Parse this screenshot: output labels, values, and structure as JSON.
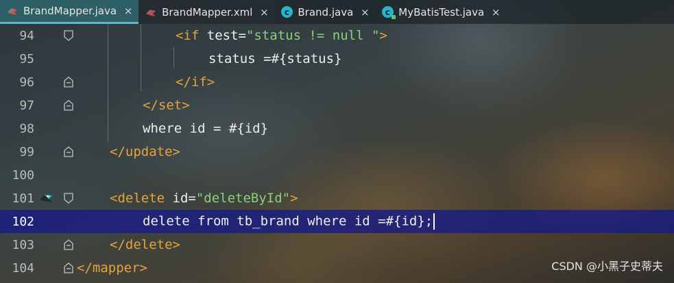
{
  "tabs": [
    {
      "label": "BrandMapper.java",
      "icon": "java-interface-icon",
      "state": "active"
    },
    {
      "label": "BrandMapper.xml",
      "icon": "mybatis-xml-icon",
      "state": "hovered"
    },
    {
      "label": "Brand.java",
      "icon": "java-class-icon",
      "state": "normal"
    },
    {
      "label": "MyBatisTest.java",
      "icon": "java-test-class-icon",
      "state": "normal"
    }
  ],
  "tab_close_glyph": "×",
  "colors": {
    "tag": "#e8a33a",
    "string": "#8bd17c",
    "current_line": "#1a1c82",
    "active_tab": "#3c8c96"
  },
  "lines": [
    {
      "number": "94",
      "tag_open": "<if ",
      "attr": "test=",
      "string": "\"status != null \"",
      "tag_close": ">"
    },
    {
      "number": "95",
      "text": "status =#{status}"
    },
    {
      "number": "96",
      "tag": "</if>"
    },
    {
      "number": "97",
      "tag": "</set>"
    },
    {
      "number": "98",
      "text": "where id = #{id}"
    },
    {
      "number": "99",
      "tag": "</update>"
    },
    {
      "number": "100"
    },
    {
      "number": "101",
      "tag_open": "<delete ",
      "attr": "id=",
      "string": "\"deleteById\"",
      "tag_close": ">",
      "gutter_icon": "mybatis-bird-icon"
    },
    {
      "number": "102",
      "text": "delete from tb_brand where id =#{id};",
      "current": true
    },
    {
      "number": "103",
      "tag": "</delete>"
    },
    {
      "number": "104",
      "tag": "</mapper>"
    }
  ],
  "watermark": "CSDN @小黑子史蒂夫"
}
